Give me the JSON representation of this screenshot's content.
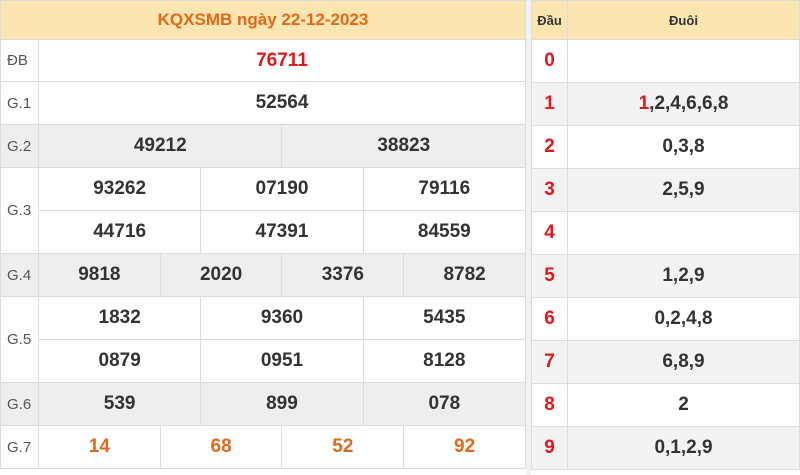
{
  "header_title": "KQXSMB ngày 22-12-2023",
  "prizes": [
    {
      "label": "ĐB",
      "numbers": [
        "76711"
      ]
    },
    {
      "label": "G.1",
      "numbers": [
        "52564"
      ]
    },
    {
      "label": "G.2",
      "numbers": [
        "49212",
        "38823"
      ]
    },
    {
      "label": "G.3",
      "numbers": [
        "93262",
        "07190",
        "79116",
        "44716",
        "47391",
        "84559"
      ]
    },
    {
      "label": "G.4",
      "numbers": [
        "9818",
        "2020",
        "3376",
        "8782"
      ]
    },
    {
      "label": "G.5",
      "numbers": [
        "1832",
        "9360",
        "5435",
        "0879",
        "0951",
        "8128"
      ]
    },
    {
      "label": "G.6",
      "numbers": [
        "539",
        "899",
        "078"
      ]
    },
    {
      "label": "G.7",
      "numbers": [
        "14",
        "68",
        "52",
        "92"
      ]
    }
  ],
  "dau_duoi": {
    "col_dau": "Đầu",
    "col_duoi": "Đuôi",
    "rows": [
      {
        "dau": "0",
        "hi": "",
        "rest": ""
      },
      {
        "dau": "1",
        "hi": "1",
        "rest": ",2,4,6,6,8"
      },
      {
        "dau": "2",
        "hi": "",
        "rest": "0,3,8"
      },
      {
        "dau": "3",
        "hi": "",
        "rest": "2,5,9"
      },
      {
        "dau": "4",
        "hi": "",
        "rest": ""
      },
      {
        "dau": "5",
        "hi": "",
        "rest": "1,2,9"
      },
      {
        "dau": "6",
        "hi": "",
        "rest": "0,2,4,8"
      },
      {
        "dau": "7",
        "hi": "",
        "rest": "6,8,9"
      },
      {
        "dau": "8",
        "hi": "",
        "rest": "2"
      },
      {
        "dau": "9",
        "hi": "",
        "rest": "0,1,2,9"
      }
    ]
  },
  "colors": {
    "header_bg": "#fbe5b0",
    "title": "#e0691a",
    "special": "#e2161b",
    "g7": "#e0691a"
  }
}
